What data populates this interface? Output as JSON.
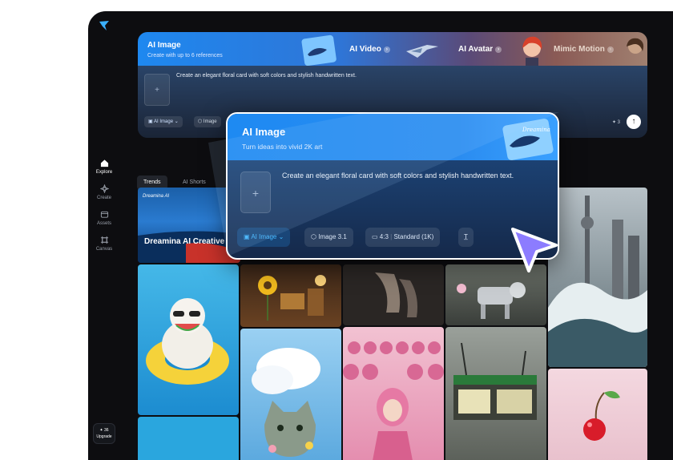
{
  "sidebar": {
    "items": [
      {
        "label": "Explore",
        "icon": "home-icon"
      },
      {
        "label": "Create",
        "icon": "sparkle-icon"
      },
      {
        "label": "Assets",
        "icon": "folder-icon"
      },
      {
        "label": "Canvas",
        "icon": "canvas-icon"
      }
    ],
    "upgrade": {
      "credits": "✦ 36",
      "label": "Upgrade"
    }
  },
  "banner": {
    "tabs": [
      {
        "title": "AI Image",
        "subtitle": "Create with up to 6 references"
      },
      {
        "title": "AI Video"
      },
      {
        "title": "AI Avatar"
      },
      {
        "title": "Mimic Motion"
      }
    ],
    "prompt": "Create an elegant floral card with soft colors and stylish handwritten text.",
    "chips": [
      "AI Image",
      "Image"
    ],
    "credits": "✦ 3",
    "send_icon": "arrow-up-icon"
  },
  "feed": {
    "tabs": [
      "Trends",
      "AI Shorts"
    ],
    "featured": {
      "brand": "Dreamina AI",
      "title": "Dreamina AI Creative"
    }
  },
  "popup": {
    "title": "AI Image",
    "subtitle": "Turn ideas into vivid 2K art",
    "prompt": "Create an elegant floral card with soft colors and stylish handwritten text.",
    "chips": {
      "mode": "AI Image",
      "model": "Image 3.1",
      "ratio": "4:3",
      "quality": "Standard (1K)"
    },
    "art_caption": "Dreamina"
  },
  "colors": {
    "accent": "#1e88f0",
    "background": "#0d0d10",
    "cursor": "#8c7cff"
  }
}
